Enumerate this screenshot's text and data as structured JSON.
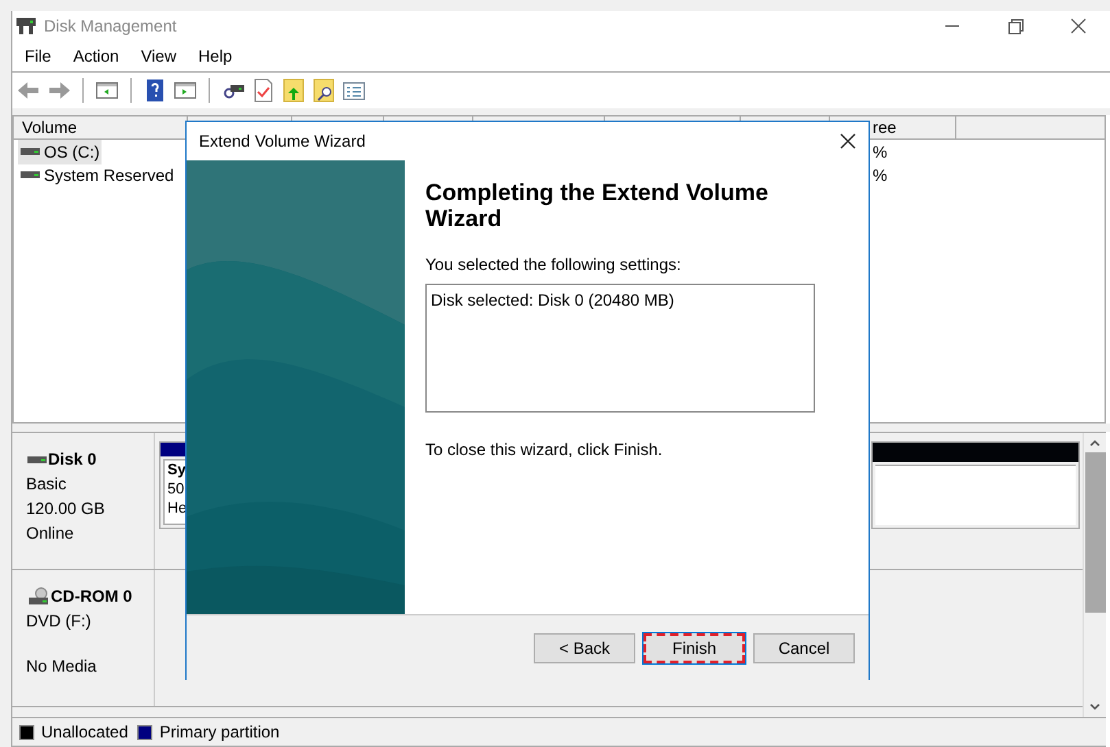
{
  "window": {
    "title": "Disk Management"
  },
  "menu": [
    "File",
    "Action",
    "View",
    "Help"
  ],
  "volume_list": {
    "columns": [
      {
        "label": "Volume"
      },
      {
        "label": "ree"
      }
    ],
    "rows": [
      {
        "volume": "OS (C:)",
        "selected": true,
        "column_2": "%"
      },
      {
        "volume": "System Reserved",
        "selected": false,
        "column_2": "%"
      }
    ]
  },
  "disks": [
    {
      "kind": "disk",
      "name": "Disk 0",
      "type": "Basic",
      "size": "120.00 GB",
      "status": "Online",
      "partitions": [
        {
          "kind": "primary",
          "lines": [
            "Sy",
            "50",
            "He"
          ]
        },
        {
          "kind": "unallocated"
        }
      ]
    },
    {
      "kind": "cdrom",
      "name": "CD-ROM 0",
      "type": "DVD (F:)",
      "status": "No Media"
    }
  ],
  "legend": [
    {
      "label": "Unallocated",
      "color": "#000000"
    },
    {
      "label": "Primary partition",
      "color": "#000080"
    }
  ],
  "dialog": {
    "title": "Extend Volume Wizard",
    "heading": "Completing the Extend Volume Wizard",
    "intro": "You selected the following settings:",
    "settings": [
      "Disk selected: Disk 0 (20480 MB)"
    ],
    "closing": "To close this wizard, click Finish.",
    "buttons": [
      {
        "label": "< Back",
        "focused": false
      },
      {
        "label": "Finish",
        "focused": true
      },
      {
        "label": "Cancel",
        "focused": false
      }
    ]
  }
}
